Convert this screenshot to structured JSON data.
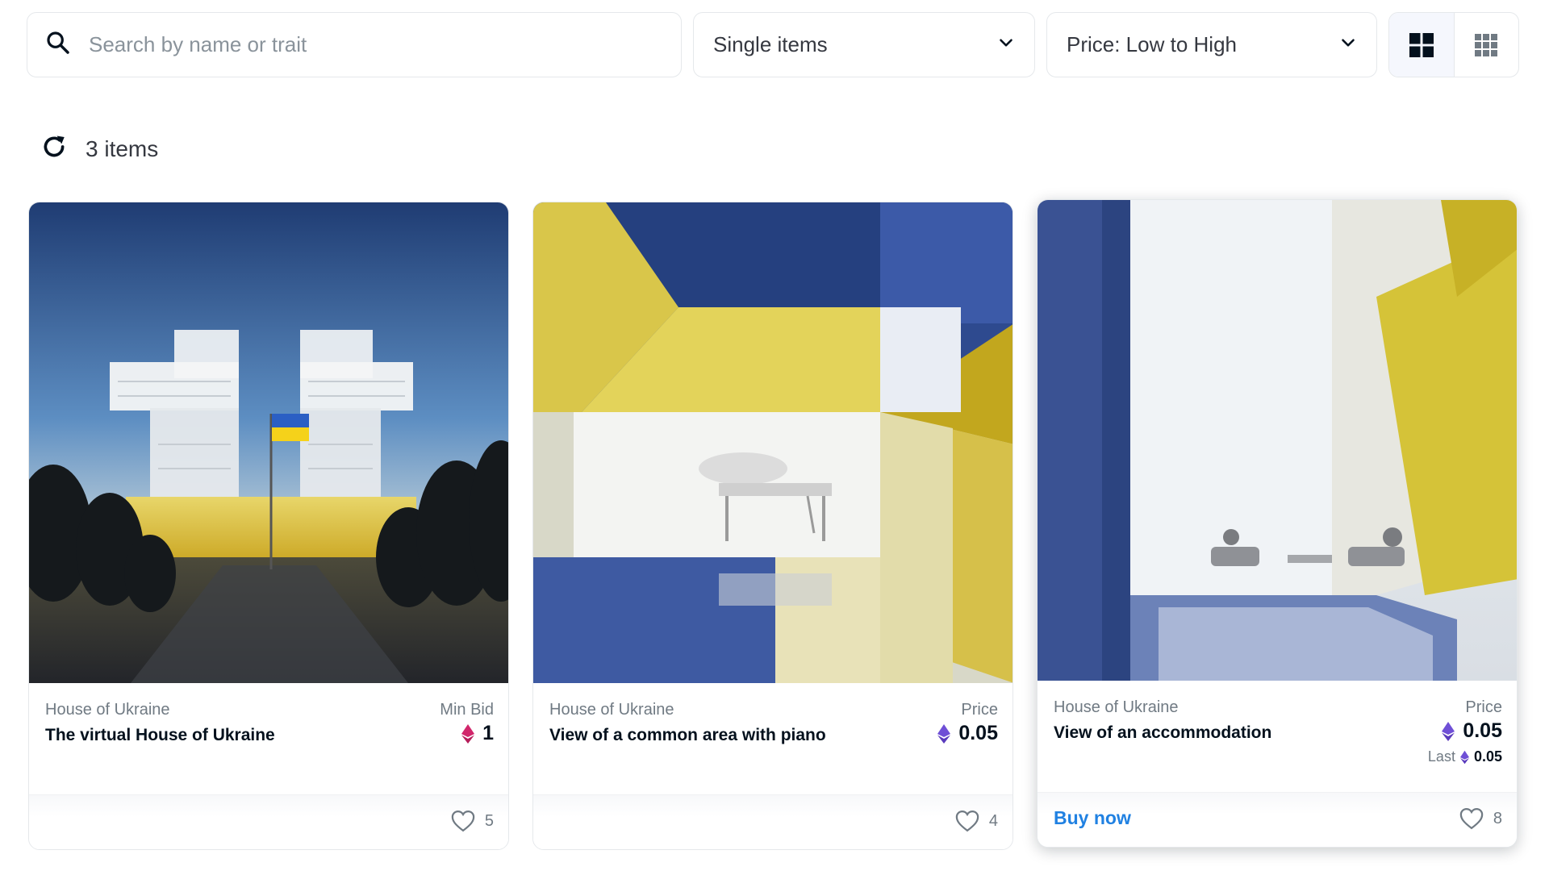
{
  "search": {
    "placeholder": "Search by name or trait",
    "value": ""
  },
  "filters": {
    "item_type": "Single items",
    "sort": "Price: Low to High"
  },
  "view_modes": [
    "large-grid",
    "compact-grid"
  ],
  "view_mode_selected": "large-grid",
  "results": {
    "count_label": "3 items"
  },
  "colors": {
    "accent_blue": "#2081e2",
    "eth_purple": "#6f4fd6",
    "weth_pink": "#d1266b",
    "text_primary": "#04111d",
    "text_secondary": "#707a83"
  },
  "cards": [
    {
      "collection": "House of Ukraine",
      "name": "The virtual House of Ukraine",
      "price_label": "Min Bid",
      "currency_icon": "weth-icon",
      "price": "1",
      "likes": "5"
    },
    {
      "collection": "House of Ukraine",
      "name": "View of a common area with piano",
      "price_label": "Price",
      "currency_icon": "eth-icon",
      "price": "0.05",
      "likes": "4"
    },
    {
      "collection": "House of Ukraine",
      "name": "View of an accommodation",
      "price_label": "Price",
      "currency_icon": "eth-icon",
      "price": "0.05",
      "last_label": "Last",
      "last_price": "0.05",
      "action_label": "Buy now",
      "likes": "8"
    }
  ]
}
